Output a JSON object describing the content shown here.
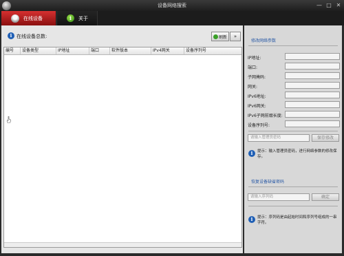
{
  "window": {
    "title": "设备网络搜索",
    "controls": {
      "minimize": "—",
      "maximize": "□",
      "close": "✕"
    }
  },
  "tabs": [
    {
      "label": "在线设备",
      "icon": "user-icon",
      "active": true
    },
    {
      "label": "关于",
      "icon": "info-icon",
      "active": false
    }
  ],
  "device_list": {
    "total_label": "在线设备总数:",
    "refresh_label": "刷新",
    "more_label": "»",
    "columns": [
      "编号",
      "设备类型",
      "IP地址",
      "端口",
      "软件版本",
      "IPv4网关",
      "设备序列号"
    ]
  },
  "network_params": {
    "title": "修改网络参数",
    "fields": [
      {
        "label": "IP地址:",
        "value": ""
      },
      {
        "label": "端口:",
        "value": ""
      },
      {
        "label": "子网掩码:",
        "value": ""
      },
      {
        "label": "网关:",
        "value": ""
      },
      {
        "label": "IPv6地址:",
        "value": ""
      },
      {
        "label": "IPv6网关:",
        "value": ""
      },
      {
        "label": "IPv6子网前缀长度:",
        "value": ""
      },
      {
        "label": "设备序列号:",
        "value": ""
      }
    ],
    "admin_password_placeholder": "请输入管理员密码",
    "save_label": "保存修改",
    "tip": "提示：输入管理员密码，进行网络参数的修改保存。"
  },
  "restore_password": {
    "title": "恢复设备缺省密码",
    "serial_placeholder": "请输入序列码",
    "confirm_label": "确定",
    "tip": "提示：序列码是由起始时间和序列号组成的一串字符。"
  },
  "colors": {
    "active_tab": "#c81e1e",
    "accent_blue": "#1f5fb5",
    "section_title": "#2a5aa6"
  }
}
